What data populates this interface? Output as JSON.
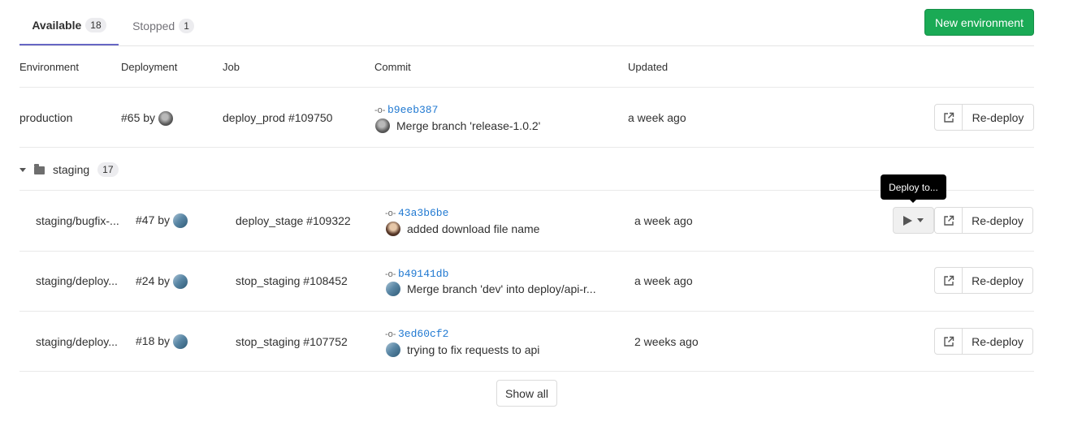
{
  "tabs": {
    "available": {
      "label": "Available",
      "count": "18"
    },
    "stopped": {
      "label": "Stopped",
      "count": "1"
    }
  },
  "new_env_button": "New environment",
  "columns": {
    "environment": "Environment",
    "deployment": "Deployment",
    "job": "Job",
    "commit": "Commit",
    "updated": "Updated"
  },
  "production": {
    "env": "production",
    "deployment": "#65 by",
    "job": "deploy_prod #109750",
    "sha": "b9eeb387",
    "message": "Merge branch 'release-1.0.2'",
    "updated": "a week ago"
  },
  "folder": {
    "name": "staging",
    "count": "17"
  },
  "staging_rows": [
    {
      "env": "staging/bugfix-...",
      "deployment": "#47 by",
      "job": "deploy_stage #109322",
      "sha": "43a3b6be",
      "message": "added download file name",
      "updated": "a week ago"
    },
    {
      "env": "staging/deploy...",
      "deployment": "#24 by",
      "job": "stop_staging #108452",
      "sha": "b49141db",
      "message": "Merge branch 'dev' into deploy/api-r...",
      "updated": "a week ago"
    },
    {
      "env": "staging/deploy...",
      "deployment": "#18 by",
      "job": "stop_staging #107752",
      "sha": "3ed60cf2",
      "message": "trying to fix requests to api",
      "updated": "2 weeks ago"
    }
  ],
  "actions": {
    "redeploy": "Re-deploy",
    "tooltip": "Deploy to..."
  },
  "show_all": "Show all",
  "icons": {
    "play": "play-icon",
    "chevron": "chevron-down-icon",
    "external": "external-link-icon",
    "commit": "commit-icon",
    "folder": "folder-icon",
    "caret": "caret-down-icon"
  }
}
